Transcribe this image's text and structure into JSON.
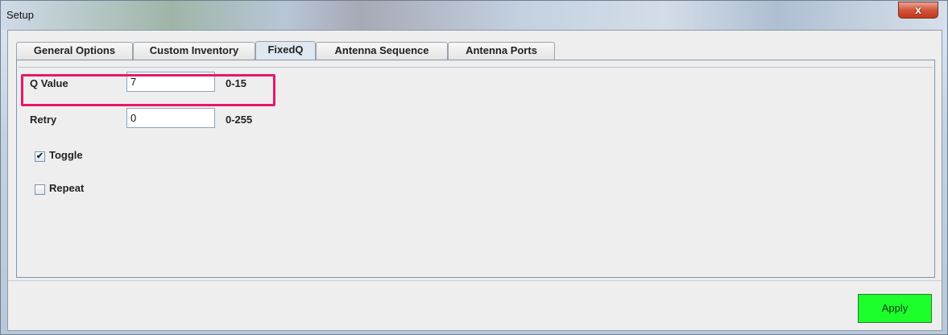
{
  "window": {
    "title": "Setup",
    "close_glyph": "x"
  },
  "tabs": [
    {
      "label": "General Options",
      "active": false
    },
    {
      "label": "Custom Inventory",
      "active": false
    },
    {
      "label": "FixedQ",
      "active": true
    },
    {
      "label": "Antenna Sequence",
      "active": false
    },
    {
      "label": "Antenna Ports",
      "active": false
    }
  ],
  "fixedq": {
    "q_value": {
      "label": "Q Value",
      "value": "7",
      "range": "0-15"
    },
    "retry": {
      "label": "Retry",
      "value": "0",
      "range": "0-255"
    },
    "toggle": {
      "label": "Toggle",
      "checked": true,
      "check_glyph": "✔"
    },
    "repeat": {
      "label": "Repeat",
      "checked": false
    }
  },
  "footer": {
    "apply_label": "Apply"
  },
  "colors": {
    "highlight": "#e6186b",
    "apply_bg": "#1dff2b"
  }
}
